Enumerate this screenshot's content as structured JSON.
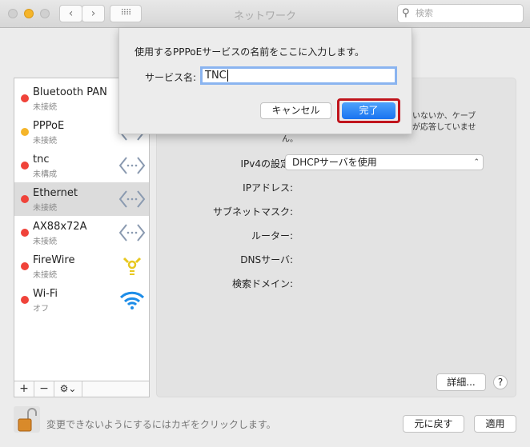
{
  "window": {
    "title": "ネットワーク",
    "search_placeholder": "検索"
  },
  "sidebar": {
    "items": [
      {
        "name": "Bluetooth PAN",
        "status": "未接続",
        "color": "#f0433a",
        "icon": "bluetooth-icon"
      },
      {
        "name": "PPPoE",
        "status": "未接続",
        "color": "#f5b52a",
        "icon": "ethernet-icon"
      },
      {
        "name": "tnc",
        "status": "未構成",
        "color": "#f0433a",
        "icon": "ethernet-icon"
      },
      {
        "name": "Ethernet",
        "status": "未接続",
        "color": "#f0433a",
        "icon": "ethernet-icon",
        "selected": true
      },
      {
        "name": "AX88x72A",
        "status": "未接続",
        "color": "#f0433a",
        "icon": "ethernet-icon"
      },
      {
        "name": "FireWire",
        "status": "未接続",
        "color": "#f0433a",
        "icon": "firewire-icon"
      },
      {
        "name": "Wi-Fi",
        "status": "オフ",
        "color": "#f0433a",
        "icon": "wifi-icon"
      }
    ],
    "add": "+",
    "remove": "−",
    "gear": "⚙⌄"
  },
  "panel": {
    "partial_text": [
      "いないか、ケーブ",
      "が応答していませ",
      "ん。"
    ],
    "ipv4_label": "IPv4の設定:",
    "ipv4_value": "DHCPサーバを使用",
    "ip_label": "IPアドレス:",
    "subnet_label": "サブネットマスク:",
    "router_label": "ルーター:",
    "dns_label": "DNSサーバ:",
    "search_domain_label": "検索ドメイン:",
    "advanced": "詳細...",
    "help": "?"
  },
  "footer": {
    "lock_text": "変更できないようにするにはカギをクリックします。",
    "revert": "元に戻す",
    "apply": "適用"
  },
  "sheet": {
    "message": "使用するPPPoEサービスの名前をここに入力します。",
    "field_label": "サービス名:",
    "field_value": "TNC",
    "cancel": "キャンセル",
    "done": "完了",
    "accent": "#1a73f0",
    "highlight": "#c0141c"
  }
}
